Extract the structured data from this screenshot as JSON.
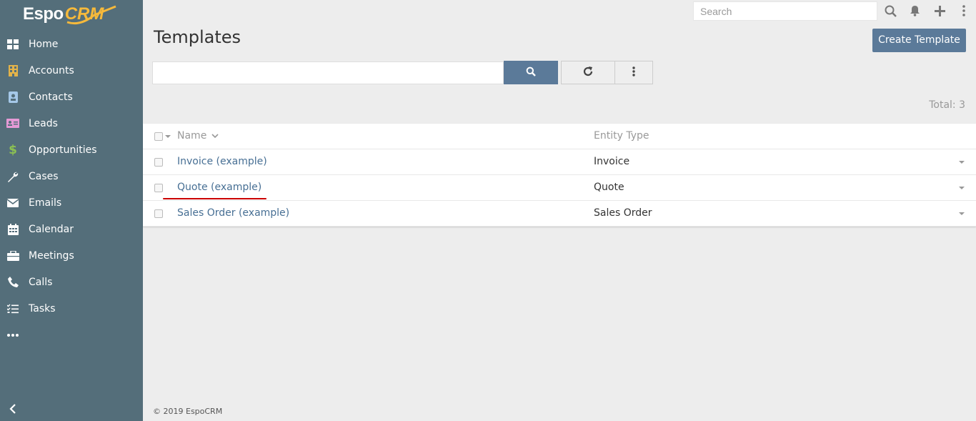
{
  "app": {
    "logo_text_left": "Espo",
    "logo_text_right": "CRM",
    "brand_accent": "#f6b93b",
    "sidebar_color": "#546e7a"
  },
  "sidebar": {
    "items": [
      {
        "label": "Home",
        "icon": "th-large-icon",
        "color": "#ffffff"
      },
      {
        "label": "Accounts",
        "icon": "building-icon",
        "color": "#e3b34a"
      },
      {
        "label": "Contacts",
        "icon": "id-badge-icon",
        "color": "#a5c8e8"
      },
      {
        "label": "Leads",
        "icon": "address-card-icon",
        "color": "#e59ad6"
      },
      {
        "label": "Opportunities",
        "icon": "dollar-icon",
        "color": "#8cc152"
      },
      {
        "label": "Cases",
        "icon": "wrench-icon",
        "color": "#ffffff"
      },
      {
        "label": "Emails",
        "icon": "envelope-icon",
        "color": "#ffffff"
      },
      {
        "label": "Calendar",
        "icon": "calendar-icon",
        "color": "#ffffff"
      },
      {
        "label": "Meetings",
        "icon": "briefcase-icon",
        "color": "#ffffff"
      },
      {
        "label": "Calls",
        "icon": "phone-icon",
        "color": "#ffffff"
      },
      {
        "label": "Tasks",
        "icon": "tasks-icon",
        "color": "#ffffff"
      },
      {
        "label": "",
        "icon": "more-icon",
        "color": "#ffffff"
      }
    ]
  },
  "topbar": {
    "search_placeholder": "Search"
  },
  "header": {
    "title": "Templates",
    "create_label": "Create Template"
  },
  "list": {
    "total_label": "Total: 3",
    "columns": [
      "Name",
      "Entity Type"
    ],
    "rows": [
      {
        "name": "Invoice (example)",
        "entity_type": "Invoice"
      },
      {
        "name": "Quote (example)",
        "entity_type": "Quote"
      },
      {
        "name": "Sales Order (example)",
        "entity_type": "Sales Order"
      }
    ]
  },
  "footer": {
    "text": "© 2019 EspoCRM"
  }
}
